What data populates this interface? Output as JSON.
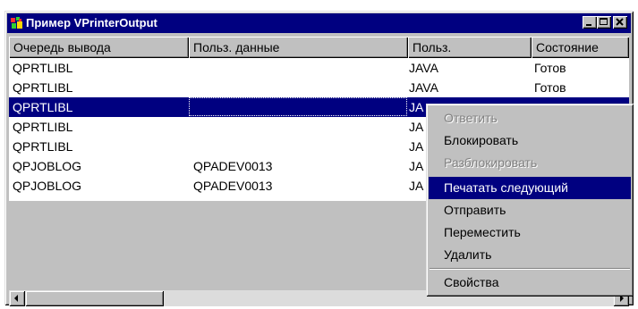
{
  "window": {
    "title": "Пример VPrinterOutput",
    "buttons": [
      {
        "name": "minimize",
        "icon": "minimize-icon"
      },
      {
        "name": "maximize",
        "icon": "maximize-icon"
      },
      {
        "name": "close",
        "icon": "close-icon"
      }
    ]
  },
  "table": {
    "columns": [
      "Очередь вывода",
      "Польз. данные",
      "Польз.",
      "Состояние"
    ],
    "rows": [
      [
        "QPRTLIBL",
        "",
        "JAVA",
        "Готов"
      ],
      [
        "QPRTLIBL",
        "",
        "JAVA",
        "Готов"
      ],
      [
        "QPRTLIBL",
        "",
        "JA",
        ""
      ],
      [
        "QPRTLIBL",
        "",
        "JA",
        ""
      ],
      [
        "QPRTLIBL",
        "",
        "JA",
        ""
      ],
      [
        "QPJOBLOG",
        "QPADEV0013",
        "JA",
        ""
      ],
      [
        "QPJOBLOG",
        "QPADEV0013",
        "JA",
        ""
      ]
    ],
    "selected_row": 2
  },
  "context_menu": {
    "items": [
      {
        "label": "Ответить",
        "enabled": false
      },
      {
        "label": "Блокировать",
        "enabled": true
      },
      {
        "label": "Разблокировать",
        "enabled": false
      },
      {
        "label": "Печатать следующий",
        "enabled": true,
        "highlighted": true
      },
      {
        "label": "Отправить",
        "enabled": true
      },
      {
        "label": "Переместить",
        "enabled": true
      },
      {
        "label": "Удалить",
        "enabled": true
      },
      {
        "separator": true
      },
      {
        "label": "Свойства",
        "enabled": true
      }
    ]
  },
  "colors": {
    "titlebar": "#000080",
    "selection": "#000080",
    "face": "#c0c0c0"
  }
}
